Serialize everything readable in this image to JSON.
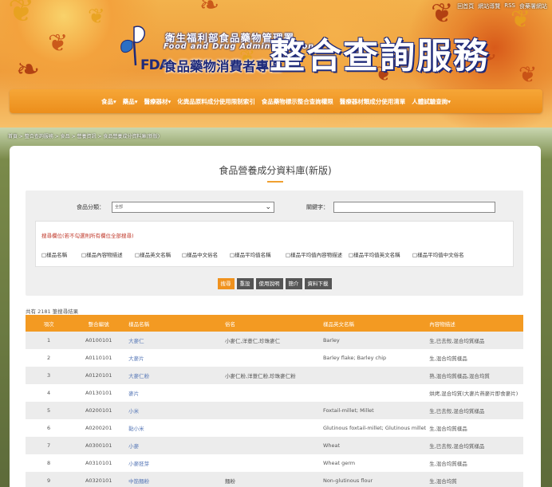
{
  "top_links": [
    "回首頁",
    "網站導覽",
    "RSS",
    "食藥署網站"
  ],
  "brand": {
    "org_cn": "衛生福利部食品藥物管理署",
    "org_en": "Food and Drug Administration",
    "fda": "FDA",
    "subtitle": "食品藥物消費者專區",
    "title": "整合查詢服務"
  },
  "nav": [
    "食品▾",
    "藥品▾",
    "醫療器材▾",
    "化粪品原料成分使用限制索引",
    "食品藥物標示整合查詢權限",
    "醫療器材類成分使用清單",
    "人體試驗查詢▾"
  ],
  "breadcrumb": "首頁 > 整合查詢服務 > 食品 > 營養資訊 > 食品營養成分資料庫(新版)",
  "page_title": "食品營養成分資料庫(新版)",
  "search": {
    "category_label": "食品分類：",
    "category_value": "全部",
    "keyword_label": "關鍵字：",
    "keyword_value": "",
    "fields_note": "搜尋欄位(若不勾選則所有欄位全部搜尋)",
    "fields": [
      "樣品名稱",
      "樣品內容物描述",
      "樣品英文名稱",
      "樣品中文俗名",
      "樣品平均值名稱",
      "樣品平均值內容物描述",
      "樣品平均值英文名稱",
      "樣品平均值中文俗名"
    ],
    "buttons": [
      "搜尋",
      "重設",
      "使用說明",
      "簡介",
      "資料下載"
    ]
  },
  "result_count": "共有 2181 筆搜尋結果",
  "table": {
    "headers": [
      "項次",
      "整合編號",
      "樣品名稱",
      "俗名",
      "樣品英文名稱",
      "內容物描述"
    ],
    "rows": [
      [
        "1",
        "A0100101",
        "大麥仁",
        "小麥仁,洋薏仁,珍珠麥仁",
        "Barley",
        "生,已去殼,混合均質樣品"
      ],
      [
        "2",
        "A0110101",
        "大麥片",
        "",
        "Barley flake; Barley chip",
        "生,混合均質樣品"
      ],
      [
        "3",
        "A0120101",
        "大麥仁粉",
        "小麥仁粉,洋薏仁粉,珍珠麥仁粉",
        "",
        "熟,混合均質樣品,混合均質"
      ],
      [
        "4",
        "A0130101",
        "麥片",
        "",
        "",
        "烘烤,混合均質(大麥片燕麥片即食麥片)"
      ],
      [
        "5",
        "A0200101",
        "小米",
        "",
        "Foxtail-millet; Millet",
        "生,已去殼,混合均質樣品"
      ],
      [
        "6",
        "A0200201",
        "黏小米",
        "",
        "Glutinous foxtail-millet; Glutinous millet",
        "生,混合均質樣品"
      ],
      [
        "7",
        "A0300101",
        "小麥",
        "",
        "Wheat",
        "生,已去殼,混合均質樣品"
      ],
      [
        "8",
        "A0310101",
        "小麥胚芽",
        "",
        "Wheat germ",
        "生,混合均質樣品"
      ],
      [
        "9",
        "A0320101",
        "中筋麵粉",
        "麵粉",
        "Non-glutinous flour",
        "生,混合均質"
      ]
    ]
  },
  "colors": {
    "accent": "#f39a22",
    "brand_navy": "#1e2a7a",
    "link": "#5a7ab8"
  }
}
